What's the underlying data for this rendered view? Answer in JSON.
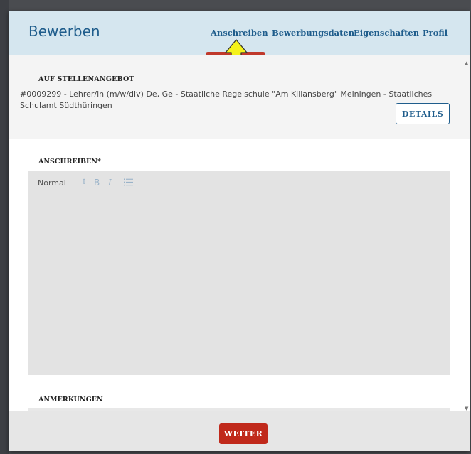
{
  "modal": {
    "title": "Bewerben"
  },
  "tabs": [
    {
      "label": "Anschreiben",
      "active": true
    },
    {
      "label": "Bewerbungsdaten",
      "active": false
    },
    {
      "label": "Eigenschaften",
      "active": false
    },
    {
      "label": "Profil",
      "active": false
    }
  ],
  "offer": {
    "section_label": "AUF STELLENANGEBOT",
    "text": "#0009299 - Lehrer/in (m/w/div) De, Ge - Staatliche Regelschule \"Am Kiliansberg\" Meiningen - Staatliches Schulamt Südthüringen",
    "details_button": "DETAILS"
  },
  "cover_letter": {
    "label": "ANSCHREIBEN*",
    "toolbar": {
      "format_select": "Normal",
      "bold": "B",
      "italic": "I"
    },
    "value": ""
  },
  "remarks": {
    "label": "ANMERKUNGEN"
  },
  "footer": {
    "next_button": "WEITER"
  },
  "colors": {
    "header_bg": "#d5e6ef",
    "accent_blue": "#1f5d8c",
    "primary_red": "#c0291b",
    "annotation_arrow": "#f5f21a"
  },
  "icons": {
    "annotation": "up-arrow-icon",
    "list": "list-icon",
    "select": "select-arrows-icon"
  }
}
